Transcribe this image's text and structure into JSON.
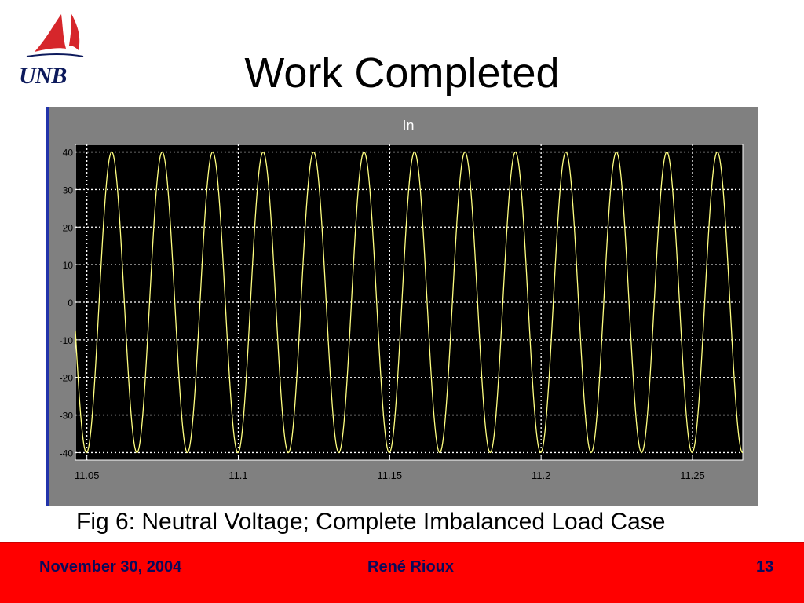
{
  "slide": {
    "title": "Work Completed",
    "logo_text": "UNB",
    "caption": "Fig 6: Neutral Voltage; Complete Imbalanced Load Case"
  },
  "footer": {
    "date": "November 30, 2004",
    "author": "René Rioux",
    "page": "13"
  },
  "colors": {
    "footer_bg": "#ff0000",
    "footer_text": "#0a0a5a",
    "plot_bg": "#000000",
    "frame_bg": "#808080",
    "trace": "#ffff80",
    "grid": "#ffffff",
    "logo_red": "#d6262b",
    "logo_navy": "#0d1a5c"
  },
  "chart_data": {
    "type": "line",
    "title": "In",
    "xlabel": "",
    "ylabel": "",
    "xlim": [
      11.0462,
      11.2666
    ],
    "ylim": [
      -42,
      42
    ],
    "xticks": [
      11.05,
      11.1,
      11.15,
      11.2,
      11.25
    ],
    "xtick_labels": [
      "11.05",
      "11.1",
      "11.15",
      "11.2",
      "11.25"
    ],
    "yticks": [
      40,
      30,
      20,
      10,
      0,
      -10,
      -20,
      -30,
      -40
    ],
    "ytick_labels": [
      "40",
      "30",
      "20",
      "10",
      "0",
      "-10",
      "-20",
      "-30",
      "-40"
    ],
    "grid": true,
    "series": [
      {
        "waveform": "sine",
        "amplitude": 40,
        "frequency_hz": 60,
        "peak_times": [
          11.0582,
          11.0749,
          11.0915,
          11.1082,
          11.1249,
          11.1415,
          11.1582,
          11.1749,
          11.1915,
          11.2082,
          11.2249,
          11.2415,
          11.2582
        ],
        "trough_times": [
          11.0499,
          11.0666,
          11.0832,
          11.0999,
          11.1166,
          11.1332,
          11.1499,
          11.1666,
          11.1832,
          11.1999,
          11.2166,
          11.2332,
          11.2499,
          11.2666
        ]
      }
    ]
  }
}
